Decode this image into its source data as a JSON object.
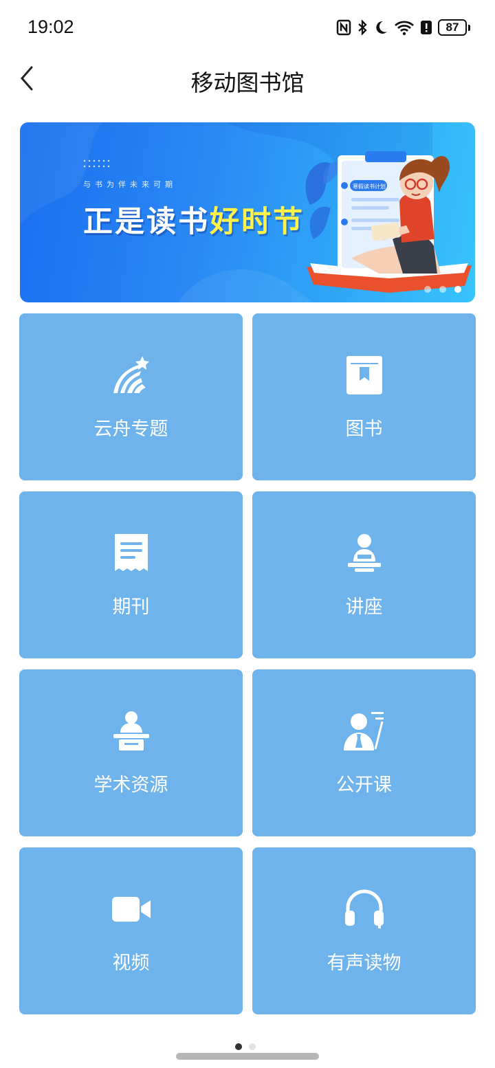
{
  "status_bar": {
    "time": "19:02",
    "battery": "87"
  },
  "header": {
    "title": "移动图书馆"
  },
  "banner": {
    "subtitle": "与书为伴未来可期",
    "title_main": "正是读书",
    "title_highlight": "好时节",
    "board_text": "寒假读书计划",
    "slides_total": 3,
    "active_slide": 3
  },
  "tiles": [
    {
      "label": "云舟专题",
      "icon": "shooting-star-icon"
    },
    {
      "label": "图书",
      "icon": "book-icon"
    },
    {
      "label": "期刊",
      "icon": "journal-icon"
    },
    {
      "label": "讲座",
      "icon": "lecture-icon"
    },
    {
      "label": "学术资源",
      "icon": "podium-icon"
    },
    {
      "label": "公开课",
      "icon": "teacher-icon"
    },
    {
      "label": "视频",
      "icon": "video-camera-icon"
    },
    {
      "label": "有声读物",
      "icon": "headphones-icon"
    }
  ],
  "pager": {
    "pages": 2,
    "current": 1
  },
  "colors": {
    "tile_bg": "#6fb3ec",
    "banner_start": "#1b6ff0",
    "banner_end": "#38c4fb",
    "highlight": "#fff34a"
  }
}
